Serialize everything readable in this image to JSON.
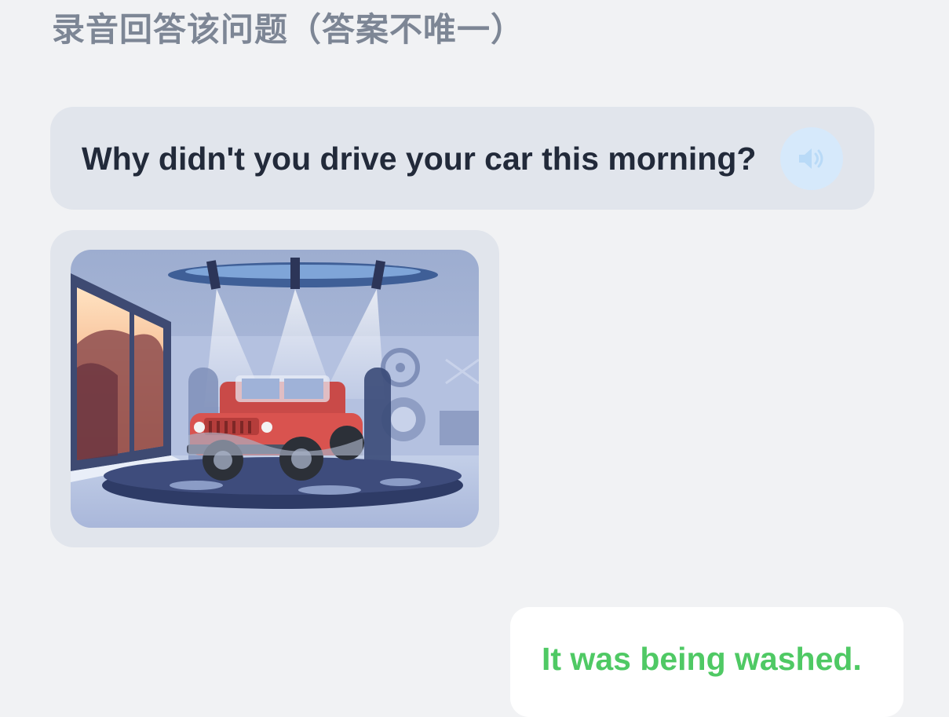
{
  "instruction": "录音回答该问题（答案不唯一）",
  "question": {
    "text": "Why didn't you drive your car this morning?",
    "audio_icon": "speaker-icon"
  },
  "illustration": {
    "icon": "car-wash-illustration"
  },
  "answer": {
    "text": "It was being washed."
  },
  "colors": {
    "background": "#f1f2f4",
    "bubble": "#e1e5ec",
    "instruction_text": "#7d8695",
    "question_text": "#222a3a",
    "answer_text": "#4fc964",
    "audio_button": "#d6e9fb",
    "car": "#d9534f"
  }
}
